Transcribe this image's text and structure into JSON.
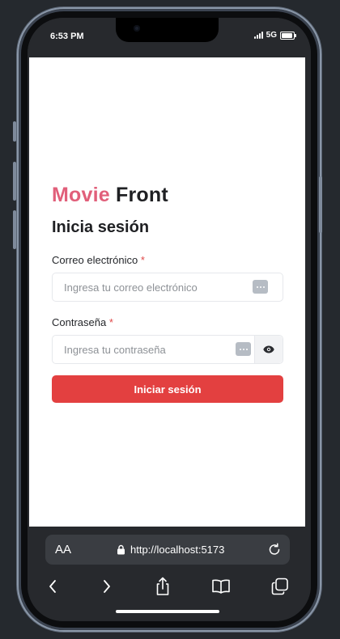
{
  "status_bar": {
    "time": "6:53 PM",
    "network": "5G"
  },
  "page": {
    "brand_accent": "Movie",
    "brand_main": "Front",
    "heading": "Inicia sesión",
    "email": {
      "label": "Correo electrónico",
      "required_mark": "*",
      "placeholder": "Ingresa tu correo electrónico",
      "value": ""
    },
    "password": {
      "label": "Contraseña",
      "required_mark": "*",
      "placeholder": "Ingresa tu contraseña",
      "value": ""
    },
    "submit_label": "Iniciar sesión"
  },
  "browser": {
    "text_size_label": "AA",
    "url": "http://localhost:5173",
    "icons": [
      "lock-icon",
      "reload-icon",
      "back-icon",
      "forward-icon",
      "share-icon",
      "bookmarks-icon",
      "tabs-icon"
    ]
  },
  "colors": {
    "brand_accent": "#e15f7a",
    "button": "#e34040",
    "required": "#e04848"
  }
}
